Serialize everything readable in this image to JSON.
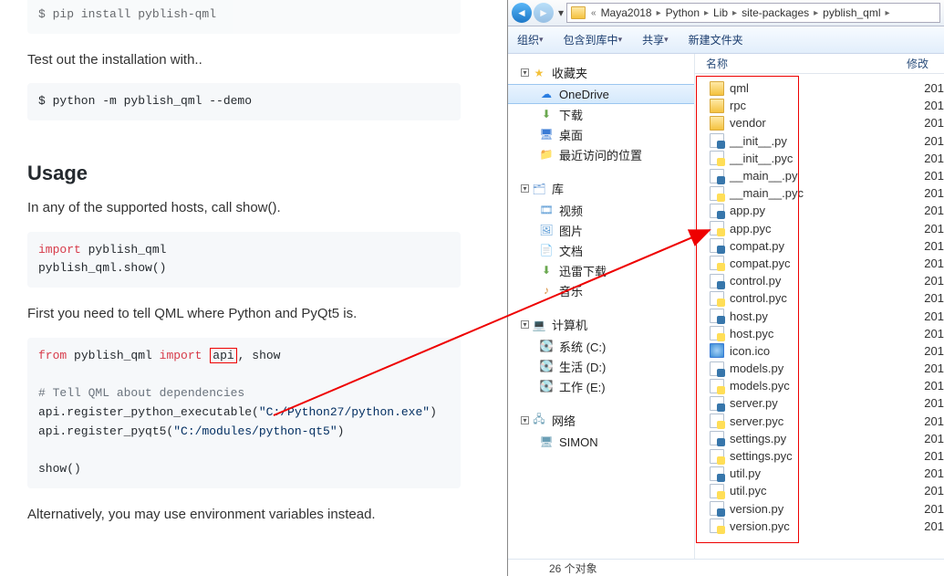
{
  "doc": {
    "code0": "$ pip install pyblish-qml",
    "test_text": "Test out the installation with..",
    "code1": "$ python -m pyblish_qml --demo",
    "usage_heading": "Usage",
    "usage_text": "In any of the supported hosts, call show().",
    "code2_l1a": "import",
    "code2_l1b": " pyblish_qml",
    "code2_l2": "pyblish_qml.show()",
    "tell_text": "First you need to tell QML where Python and PyQt5 is.",
    "code3_l1a": "from",
    "code3_l1b": " pyblish_qml ",
    "code3_l1c": "import",
    "code3_l1d": "api",
    "code3_l1e": ", show",
    "code3_l3": "# Tell QML about dependencies",
    "code3_l4a": "api.register_python_executable(",
    "code3_l4b": "\"C:/Python27/python.exe\"",
    "code3_l4c": ")",
    "code3_l5a": "api.register_pyqt5(",
    "code3_l5b": "\"C:/modules/python-qt5\"",
    "code3_l5c": ")",
    "code3_l7": "show()",
    "alt_text": "Alternatively, you may use environment variables instead."
  },
  "explorer": {
    "crumbs": [
      "Maya2018",
      "Python",
      "Lib",
      "site-packages",
      "pyblish_qml"
    ],
    "toolbar": {
      "organize": "组织",
      "include": "包含到库中",
      "share": "共享",
      "new_folder": "新建文件夹"
    },
    "nav": {
      "favorites": "收藏夹",
      "onedrive": "OneDrive",
      "downloads": "下载",
      "desktop": "桌面",
      "recent": "最近访问的位置",
      "libraries": "库",
      "videos": "视频",
      "pictures": "图片",
      "documents": "文档",
      "thunder": "迅雷下载",
      "music": "音乐",
      "computer": "计算机",
      "drive_c": "系统 (C:)",
      "drive_d": "生活 (D:)",
      "drive_e": "工作 (E:)",
      "network": "网络",
      "simon": "SIMON"
    },
    "columns": {
      "name": "名称",
      "modified": "修改"
    },
    "files": [
      {
        "name": "qml",
        "type": "folder",
        "date": "201"
      },
      {
        "name": "rpc",
        "type": "folder",
        "date": "201"
      },
      {
        "name": "vendor",
        "type": "folder",
        "date": "201"
      },
      {
        "name": "__init__.py",
        "type": "py",
        "date": "201"
      },
      {
        "name": "__init__.pyc",
        "type": "pyc",
        "date": "201"
      },
      {
        "name": "__main__.py",
        "type": "py",
        "date": "201"
      },
      {
        "name": "__main__.pyc",
        "type": "pyc",
        "date": "201"
      },
      {
        "name": "app.py",
        "type": "py",
        "date": "201"
      },
      {
        "name": "app.pyc",
        "type": "pyc",
        "date": "201"
      },
      {
        "name": "compat.py",
        "type": "py",
        "date": "201"
      },
      {
        "name": "compat.pyc",
        "type": "pyc",
        "date": "201"
      },
      {
        "name": "control.py",
        "type": "py",
        "date": "201"
      },
      {
        "name": "control.pyc",
        "type": "pyc",
        "date": "201"
      },
      {
        "name": "host.py",
        "type": "py",
        "date": "201"
      },
      {
        "name": "host.pyc",
        "type": "pyc",
        "date": "201"
      },
      {
        "name": "icon.ico",
        "type": "ico",
        "date": "201"
      },
      {
        "name": "models.py",
        "type": "py",
        "date": "201"
      },
      {
        "name": "models.pyc",
        "type": "pyc",
        "date": "201"
      },
      {
        "name": "server.py",
        "type": "py",
        "date": "201"
      },
      {
        "name": "server.pyc",
        "type": "pyc",
        "date": "201"
      },
      {
        "name": "settings.py",
        "type": "py",
        "date": "201"
      },
      {
        "name": "settings.pyc",
        "type": "pyc",
        "date": "201"
      },
      {
        "name": "util.py",
        "type": "py",
        "date": "201"
      },
      {
        "name": "util.pyc",
        "type": "pyc",
        "date": "201"
      },
      {
        "name": "version.py",
        "type": "py",
        "date": "201"
      },
      {
        "name": "version.pyc",
        "type": "pyc",
        "date": "201"
      }
    ],
    "status": "26 个对象"
  }
}
